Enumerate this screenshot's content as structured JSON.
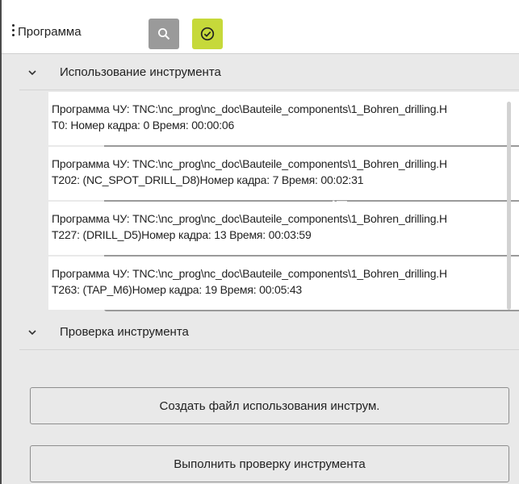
{
  "header": {
    "title": "Программа",
    "buttons": [
      {
        "icon": "list-icon",
        "color": "#9a9a9a"
      },
      {
        "icon": "search-icon",
        "color": "#9a9a9a"
      },
      {
        "icon": "check-circle-icon",
        "color": "#c6d93a",
        "active": true
      }
    ]
  },
  "tool_usage": {
    "label": "Использование инструмента",
    "expanded": true,
    "items": [
      {
        "line1": "Программа ЧУ: TNC:\\nc_prog\\nc_doc\\Bauteile_components\\1_Bohren_drilling.H",
        "line2": "T0: Номер кадра: 0 Время: 00:00:06"
      },
      {
        "line1": "Программа ЧУ: TNC:\\nc_prog\\nc_doc\\Bauteile_components\\1_Bohren_drilling.H",
        "line2": "T202: (NC_SPOT_DRILL_D8)Номер кадра: 7 Время: 00:02:31"
      },
      {
        "line1": "Программа ЧУ: TNC:\\nc_prog\\nc_doc\\Bauteile_components\\1_Bohren_drilling.H",
        "line2": "T227: (DRILL_D5)Номер кадра: 13 Время: 00:03:59"
      },
      {
        "line1": "Программа ЧУ: TNC:\\nc_prog\\nc_doc\\Bauteile_components\\1_Bohren_drilling.H",
        "line2": "T263: (TAP_M6)Номер кадра: 19 Время: 00:05:43"
      }
    ]
  },
  "tool_check": {
    "label": "Проверка инструмента",
    "expanded": true
  },
  "actions": {
    "create_label": "Создать файл использования инструм.",
    "check_label": "Выполнить проверку инструмента"
  }
}
